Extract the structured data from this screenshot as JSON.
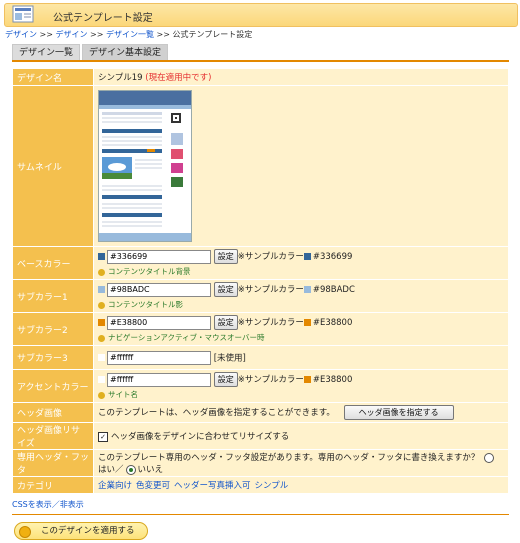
{
  "header": {
    "title": "公式テンプレート設定"
  },
  "breadcrumb": {
    "items": [
      "デザイン",
      "デザイン",
      "デザイン一覧"
    ],
    "sep": ">>",
    "current": "公式テンプレート設定"
  },
  "tabs": [
    "デザイン一覧",
    "デザイン基本設定"
  ],
  "rows": {
    "design_name": {
      "label": "デザイン名",
      "value": "シンプル19",
      "flag": "(現在適用中です)"
    },
    "thumbnail": {
      "label": "サムネイル"
    },
    "base_color": {
      "label": "ベースカラー",
      "value": "#336699",
      "button": "設定",
      "sample_prefix": "※サンプルカラー",
      "sample_value": "#336699",
      "hint": "コンテンツタイトル背景",
      "color": "#336699"
    },
    "sub_color1": {
      "label": "サブカラー1",
      "value": "#98BADC",
      "button": "設定",
      "sample_prefix": "※サンプルカラー",
      "sample_value": "#98BADC",
      "hint": "コンテンツタイトル影",
      "color": "#98BADC"
    },
    "sub_color2": {
      "label": "サブカラー2",
      "value": "#E38800",
      "button": "設定",
      "sample_prefix": "※サンプルカラー",
      "sample_value": "#E38800",
      "hint": "ナビゲーションアクティブ・マウスオーバー時",
      "color": "#E38800"
    },
    "sub_color3": {
      "label": "サブカラー3",
      "value": "#ffffff",
      "note": "[未使用]",
      "color": "#ffffff"
    },
    "accent_color": {
      "label": "アクセントカラー",
      "value": "#ffffff",
      "button": "設定",
      "sample_prefix": "※サンプルカラー",
      "sample_value": "#E38800",
      "hint": "サイト名",
      "color": "#ffffff",
      "sample_color": "#E38800"
    },
    "header_image": {
      "label": "ヘッダ画像",
      "text": "このテンプレートは、ヘッダ画像を指定することができます。",
      "button": "ヘッダ画像を指定する"
    },
    "header_resize": {
      "label": "ヘッダ画像リサイズ",
      "text": "ヘッダ画像をデザインに合わせてリサイズする",
      "checked": true
    },
    "custom_header": {
      "label": "専用ヘッダ・フッタ",
      "text": "このテンプレート専用のヘッダ・フッタ設定があります。専用のヘッダ・フッタに書き換えますか？",
      "opt_yes": "はい",
      "sep": "／",
      "opt_no": "いいえ",
      "selected": "いいえ"
    },
    "category": {
      "label": "カテゴリ",
      "items": [
        "企業向け",
        "色変更可",
        "ヘッダー写真挿入可",
        "シンプル"
      ]
    }
  },
  "css_toggle": "CSSを表示／非表示",
  "apply_button": "このデザインを適用する"
}
